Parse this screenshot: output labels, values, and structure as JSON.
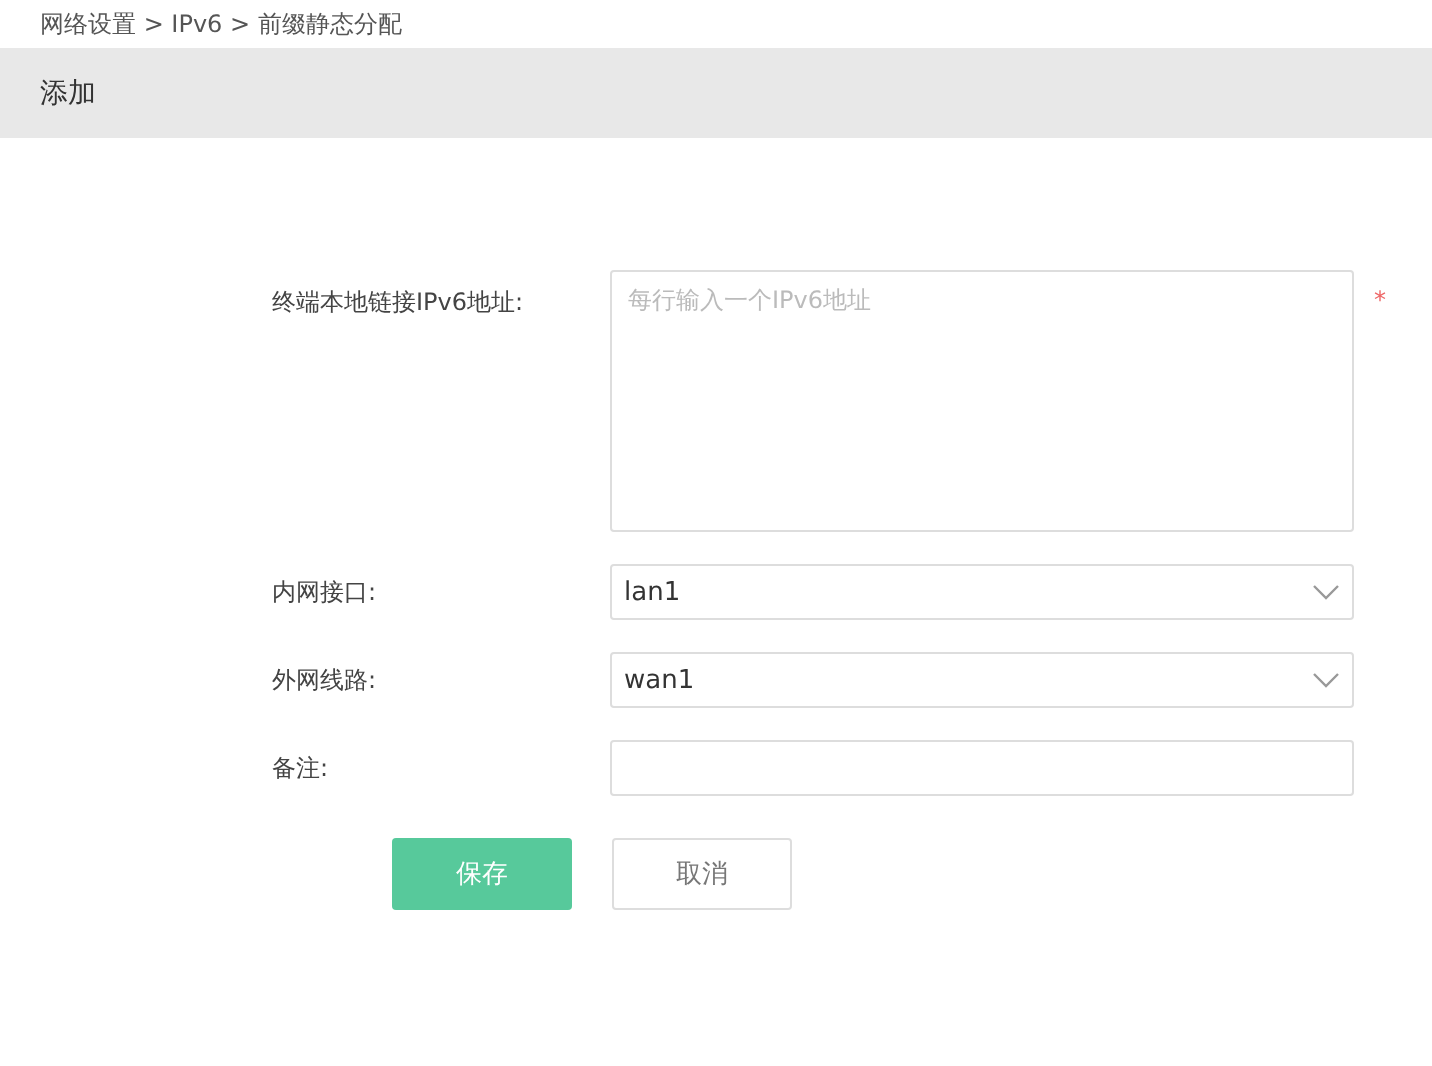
{
  "breadcrumb": "网络设置 > IPv6 > 前缀静态分配",
  "header": {
    "title": "添加"
  },
  "fields": [
    {
      "kind": "textarea",
      "label": "终端本地链接IPv6地址:",
      "placeholder": "每行输入一个IPv6地址",
      "required_mark": "*"
    },
    {
      "kind": "select",
      "label": "内网接口:",
      "value": "lan1"
    },
    {
      "kind": "select",
      "label": "外网线路:",
      "value": "wan1"
    },
    {
      "kind": "input",
      "label": "备注:"
    }
  ],
  "buttons": [
    {
      "kind": "primary",
      "label": "保存"
    },
    {
      "kind": "secondary",
      "label": "取消"
    }
  ]
}
